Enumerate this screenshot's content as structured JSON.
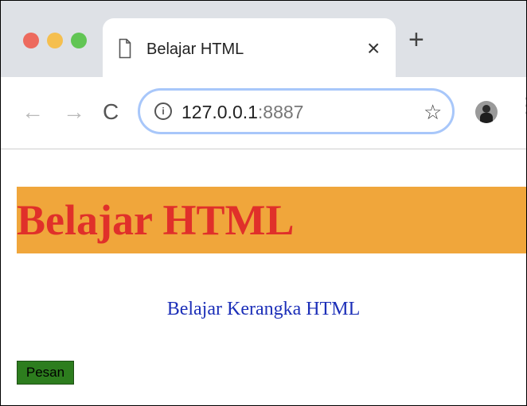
{
  "browser": {
    "tab": {
      "title": "Belajar HTML",
      "close_glyph": "×"
    },
    "new_tab_glyph": "+",
    "nav": {
      "back_glyph": "←",
      "forward_glyph": "→",
      "reload_glyph": "C"
    },
    "address": {
      "host": "127.0.0.1",
      "port": ":8887",
      "info_glyph": "i",
      "star_glyph": "☆"
    },
    "menu_glyph": "⋮",
    "colors": {
      "traffic_red": "#ed6a5e",
      "traffic_yellow": "#f5bf4f",
      "traffic_green": "#61c554"
    }
  },
  "page": {
    "heading": "Belajar HTML",
    "subtitle": "Belajar Kerangka HTML",
    "button_label": "Pesan",
    "colors": {
      "banner_bg": "#f0a63b",
      "heading_color": "#e0302a",
      "subtitle_color": "#1c2fb8",
      "button_bg": "#2d7d1e"
    }
  },
  "icons": [
    "window-close-light",
    "window-minimize-light",
    "window-zoom-light",
    "document-icon",
    "close-icon",
    "plus-icon",
    "back-arrow-icon",
    "forward-arrow-icon",
    "reload-icon",
    "info-icon",
    "star-icon",
    "avatar",
    "kebab-menu-icon"
  ]
}
